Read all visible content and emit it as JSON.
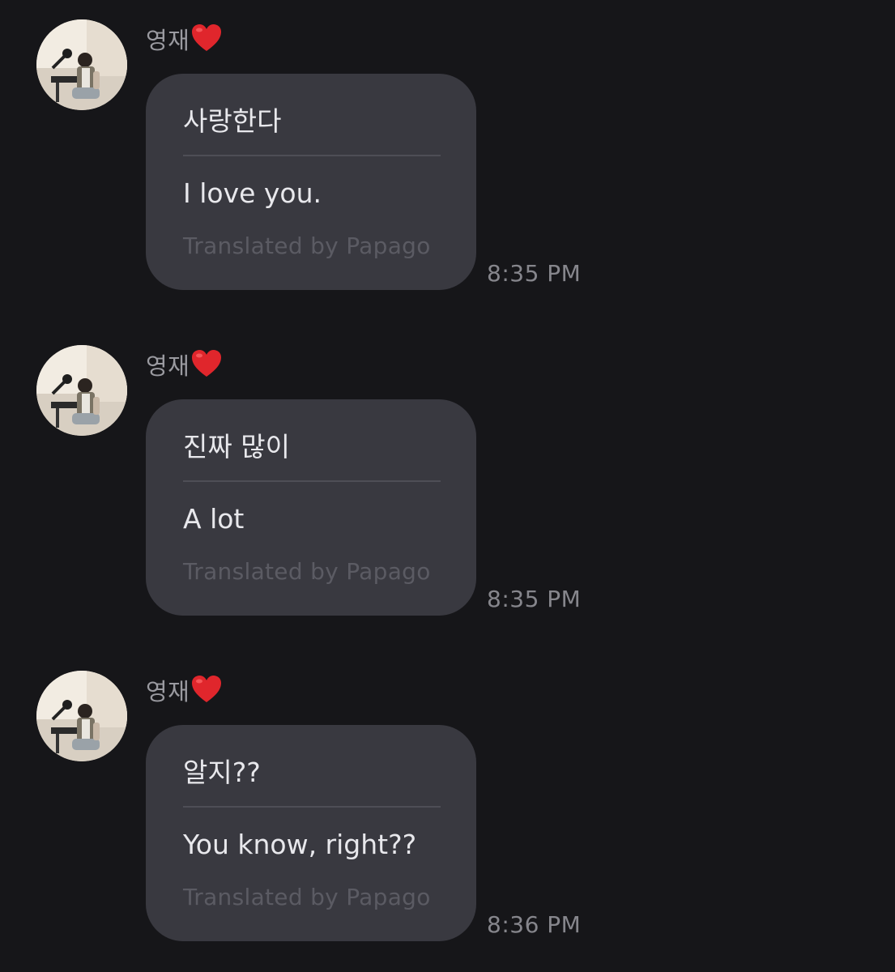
{
  "colors": {
    "background": "#161619",
    "bubble": "#393940",
    "text_primary": "#e8e8ec",
    "text_secondary": "#86868c",
    "credit": "#5b5b63",
    "heart": "#e0262c"
  },
  "messages": [
    {
      "sender": "영재",
      "sender_badge": "heart-icon",
      "original": "사랑한다",
      "translation": "I love you.",
      "credit": "Translated by Papago",
      "time": "8:35 PM"
    },
    {
      "sender": "영재",
      "sender_badge": "heart-icon",
      "original": "진짜 많이",
      "translation": "A lot",
      "credit": "Translated by Papago",
      "time": "8:35 PM"
    },
    {
      "sender": "영재",
      "sender_badge": "heart-icon",
      "original": "알지??",
      "translation": "You know, right??",
      "credit": "Translated by Papago",
      "time": "8:36 PM"
    }
  ]
}
